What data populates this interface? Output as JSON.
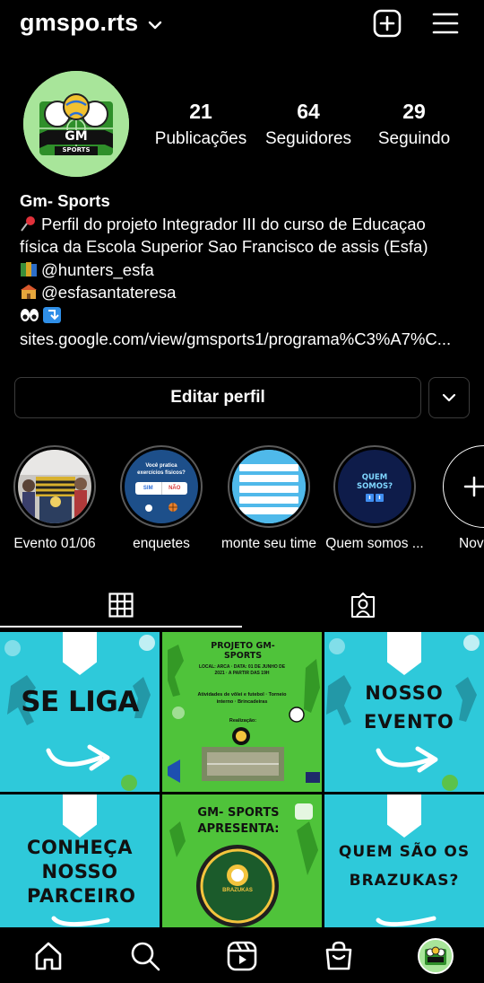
{
  "header": {
    "username": "gmspo.rts",
    "icons": [
      "chevron-down-icon",
      "plus-square-icon",
      "menu-icon"
    ]
  },
  "profile": {
    "avatar_text": "GM",
    "avatar_subtext": "SPORTS",
    "stats": [
      {
        "value": "21",
        "label": "Publicações"
      },
      {
        "value": "64",
        "label": "Seguidores"
      },
      {
        "value": "29",
        "label": "Seguindo"
      }
    ],
    "bio": {
      "name": "Gm- Sports",
      "line1": "Perfil do projeto Integrador III do curso de Educaçao",
      "line2": "física da Escola Superior Sao Francisco de assis (Esfa)",
      "line3": "@hunters_esfa",
      "line4": "@esfasantateresa",
      "link": "sites.google.com/view/gmsports1/programa%C3%A7%C..."
    }
  },
  "buttons": {
    "edit_profile": "Editar perfil"
  },
  "highlights": [
    {
      "label": "Evento 01/06"
    },
    {
      "label": "enquetes",
      "card_title": "Você pratica exercícios físicos?",
      "opt_yes": "SIM",
      "opt_no": "NÃO"
    },
    {
      "label": "monte seu time"
    },
    {
      "label": "Quem somos ...",
      "cover_text": "QUEM SOMOS?"
    },
    {
      "label": "Novo"
    }
  ],
  "tabs": [
    "grid-icon",
    "tagged-icon"
  ],
  "posts": [
    {
      "text": "SE LIGA"
    },
    {
      "title": "PROJETO GM-SPORTS",
      "details": "LOCAL: ARCA · DATA: 01 DE JUNHO DE 2021 · A PARTIR DAS 19H",
      "activities": "Atividades de vôlei e futebol · Torneio interno · Brincadeiras",
      "realizacao": "Realização:"
    },
    {
      "text": "NOSSO EVENTO"
    },
    {
      "text": "CONHEÇA NOSSO PARCEIRO"
    },
    {
      "title": "GM- SPORTS APRESENTA:",
      "badge": "BRAZUKAS"
    },
    {
      "text": "QUEM SÃO OS BRAZUKAS?"
    }
  ],
  "colors": {
    "background": "#000000",
    "post_cyan": "#2ec9da",
    "post_green": "#4fc33a",
    "button_border": "#3b3b3b"
  },
  "nav": [
    "home-icon",
    "search-icon",
    "reels-icon",
    "shop-icon",
    "profile-avatar"
  ]
}
